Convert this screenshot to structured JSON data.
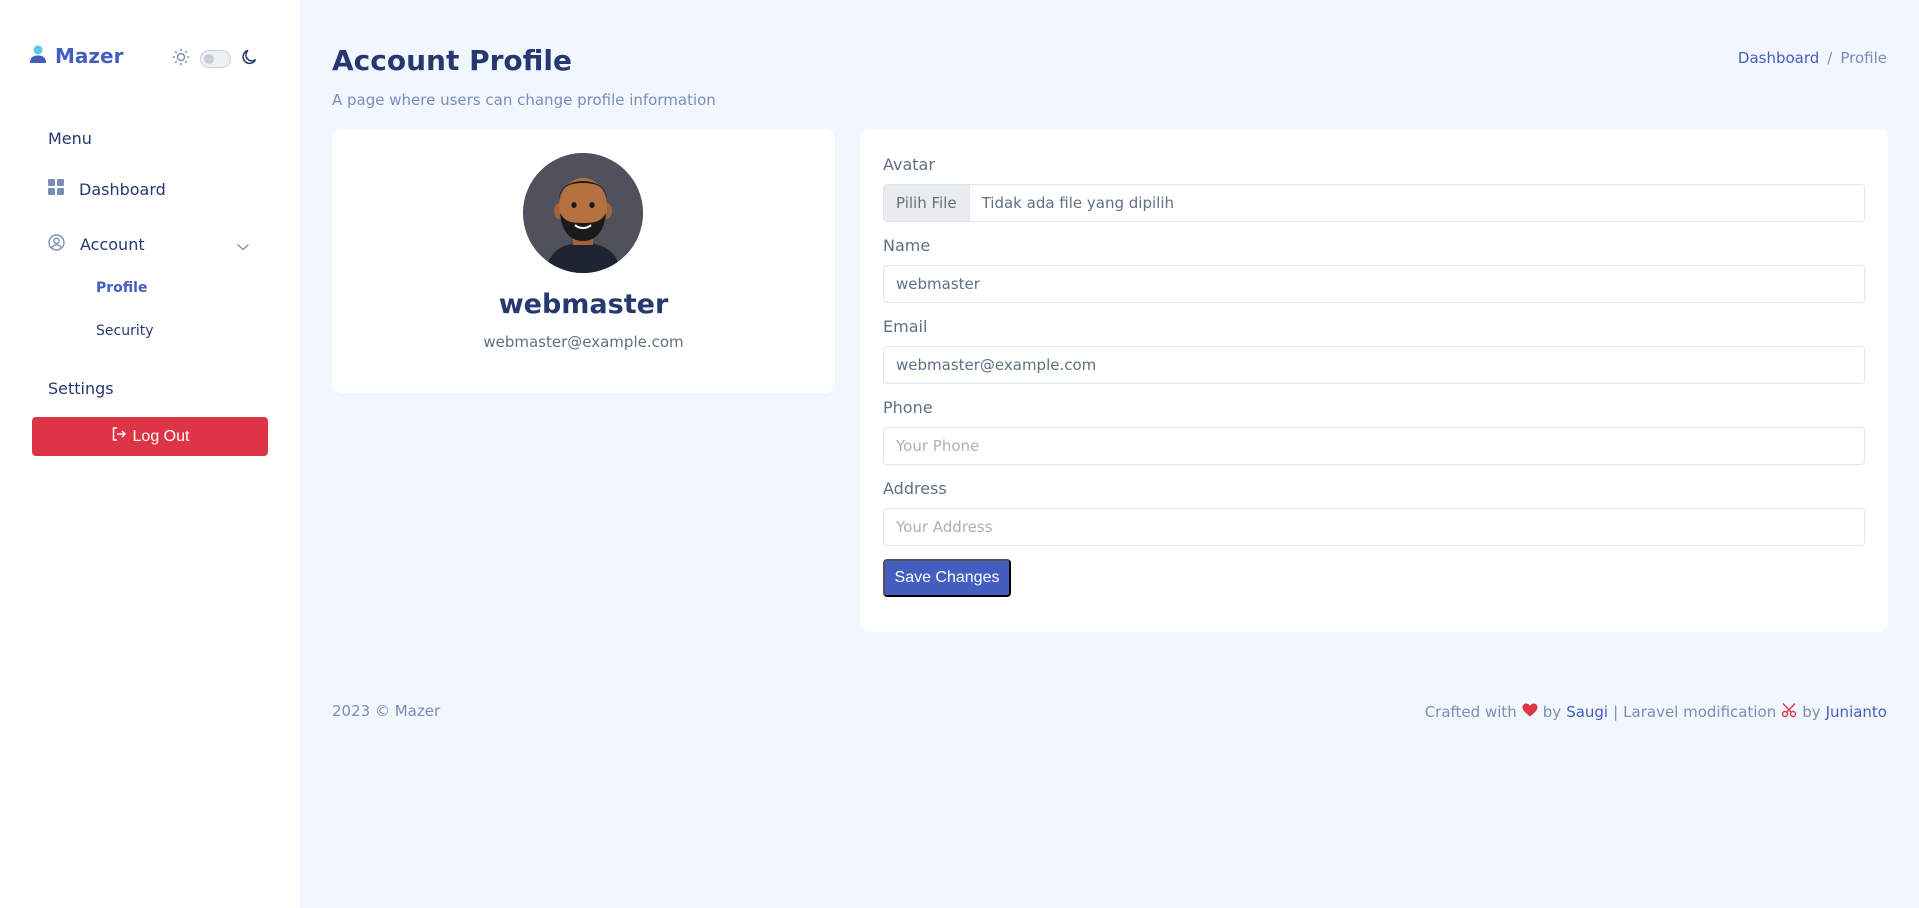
{
  "brand": {
    "name": "Mazer",
    "icon": "person-icon",
    "accent": "#435ebe"
  },
  "theme_toggle": {
    "sun_icon": "sun-icon",
    "moon_icon": "moon-icon",
    "dark_mode": false
  },
  "sidebar": {
    "menu_title": "Menu",
    "items": [
      {
        "label": "Dashboard",
        "icon": "grid-icon"
      },
      {
        "label": "Account",
        "icon": "user-circle-icon",
        "expanded": true,
        "children": [
          {
            "label": "Profile",
            "active": true
          },
          {
            "label": "Security",
            "active": false
          }
        ]
      }
    ],
    "settings_title": "Settings",
    "logout_label": "Log Out",
    "logout_color": "#dc3545"
  },
  "header": {
    "title": "Account Profile",
    "subtitle": "A page where users can change profile information",
    "breadcrumb": {
      "home": "Dashboard",
      "separator": "/",
      "current": "Profile"
    }
  },
  "profile": {
    "name": "webmaster",
    "email": "webmaster@example.com"
  },
  "form": {
    "avatar_label": "Avatar",
    "file_button": "Pilih File",
    "file_text": "Tidak ada file yang dipilih",
    "name_label": "Name",
    "name_value": "webmaster",
    "email_label": "Email",
    "email_value": "webmaster@example.com",
    "phone_label": "Phone",
    "phone_placeholder": "Your Phone",
    "address_label": "Address",
    "address_placeholder": "Your Address",
    "save_label": "Save Changes",
    "save_color": "#435ebe"
  },
  "footer": {
    "copyright": "2023 © Mazer",
    "crafted_with": "Crafted with",
    "by1": "by",
    "author1": "Saugi",
    "pipe": "|",
    "mod_text": "Laravel modification",
    "by2": "by",
    "author2": "Junianto"
  }
}
